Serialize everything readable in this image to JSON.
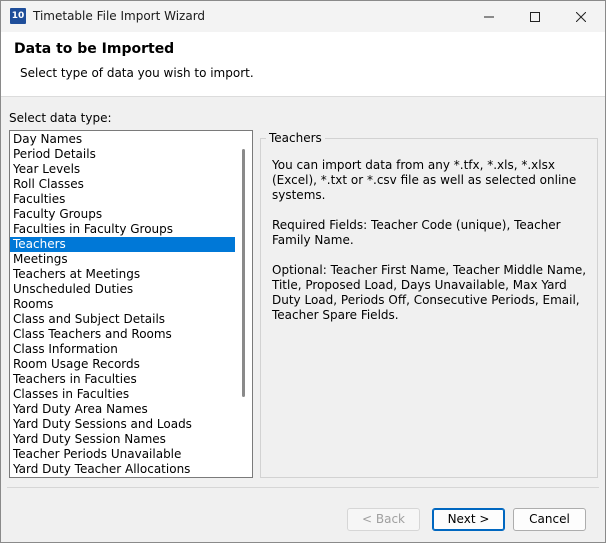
{
  "window": {
    "title": "Timetable File Import Wizard",
    "icon_text": "10"
  },
  "header": {
    "title": "Data to be Imported",
    "subtitle": "Select type of data you wish to import."
  },
  "list": {
    "label": "Select data type:",
    "selected": "Teachers",
    "items": [
      "Day Names",
      "Period Details",
      "Year Levels",
      "Roll Classes",
      "Faculties",
      "Faculty Groups",
      "Faculties in Faculty Groups",
      "Teachers",
      "Meetings",
      "Teachers at Meetings",
      "Unscheduled Duties",
      "Rooms",
      "Class and Subject Details",
      "Class Teachers and Rooms",
      "Class Information",
      "Room Usage Records",
      "Teachers in Faculties",
      "Classes in Faculties",
      "Yard Duty Area Names",
      "Yard Duty Sessions and Loads",
      "Yard Duty Session Names",
      "Teacher Periods Unavailable",
      "Yard Duty Teacher Allocations"
    ]
  },
  "details": {
    "title": "Teachers",
    "paragraphs": [
      "You can import data from any *.tfx, *.xls, *.xlsx (Excel), *.txt or *.csv file as well as selected online systems.",
      "Required Fields: Teacher Code (unique), Teacher Family Name.",
      "Optional: Teacher First Name, Teacher Middle Name, Title, Proposed Load, Days Unavailable, Max Yard Duty Load, Periods Off, Consecutive Periods, Email, Teacher Spare Fields."
    ]
  },
  "buttons": {
    "back": "< Back",
    "next": "Next >",
    "cancel": "Cancel"
  }
}
